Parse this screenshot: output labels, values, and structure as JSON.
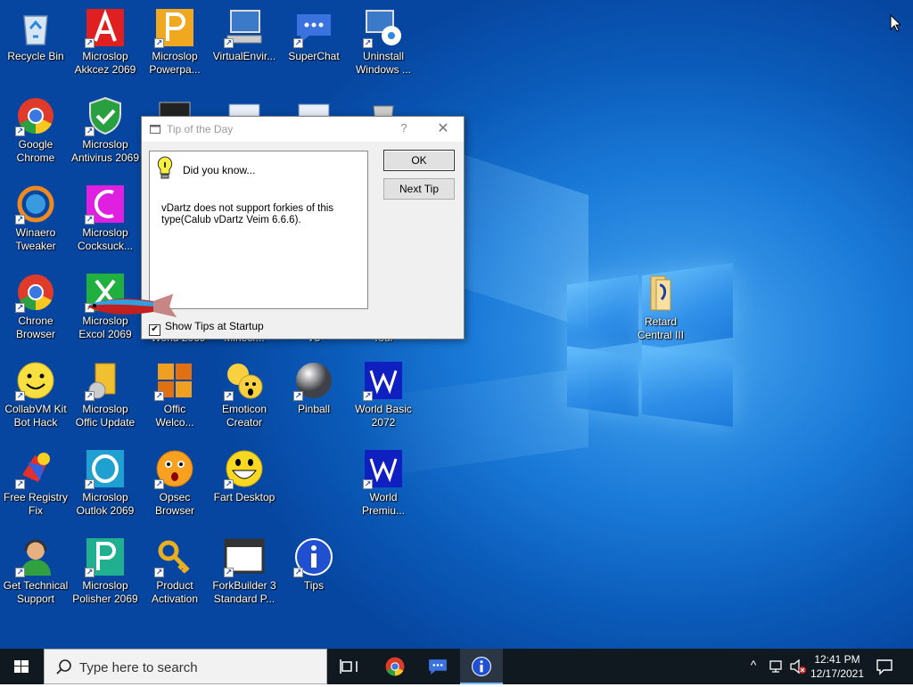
{
  "desktop": {
    "icons": [
      {
        "name": "Recycle Bin",
        "icon": "recycle-bin-icon",
        "shortcut": false
      },
      {
        "name": "Microslop\nAkkcez 2069",
        "icon": "access-icon",
        "shortcut": true
      },
      {
        "name": "Microslop\nPowerpa...",
        "icon": "powerpoint-icon",
        "shortcut": true
      },
      {
        "name": "VirtualEnvir...",
        "icon": "computer-icon",
        "shortcut": true
      },
      {
        "name": "SuperChat",
        "icon": "chat-icon",
        "shortcut": true
      },
      {
        "name": "Uninstall\nWindows ...",
        "icon": "uninstall-icon",
        "shortcut": true
      },
      {
        "name": "Google\nChrome",
        "icon": "chrome-icon",
        "shortcut": true
      },
      {
        "name": "Microslop\nAntivirus 2069",
        "icon": "antivirus-icon",
        "shortcut": true
      },
      {
        "name": "Winaero\nTweaker",
        "icon": "winaero-icon",
        "shortcut": true
      },
      {
        "name": "Microslop\nCocksuck...",
        "icon": "pink-app-icon",
        "shortcut": true
      },
      {
        "name": "Chrone\nBrowser",
        "icon": "chrome-icon",
        "shortcut": true
      },
      {
        "name": "Microslop\nExcol 2069",
        "icon": "excel-icon",
        "shortcut": true
      },
      {
        "name": "CollabVM Kit\nBot Hack",
        "icon": "smiley-icon",
        "shortcut": true
      },
      {
        "name": "Microslop\nOffic Update",
        "icon": "office-update-icon",
        "shortcut": true
      },
      {
        "name": "Offic\nWelco...",
        "icon": "office-icon",
        "shortcut": true
      },
      {
        "name": "Emoticon\nCreator",
        "icon": "emoticon-icon",
        "shortcut": true
      },
      {
        "name": "Pinball",
        "icon": "pinball-icon",
        "shortcut": true
      },
      {
        "name": "World Basic\n2072",
        "icon": "word-icon",
        "shortcut": true
      },
      {
        "name": "Free Registry\nFix",
        "icon": "registry-icon",
        "shortcut": true
      },
      {
        "name": "Microslop\nOutlok 2069",
        "icon": "outlook-icon",
        "shortcut": true
      },
      {
        "name": "Opsec\nBrowser",
        "icon": "opsec-icon",
        "shortcut": true
      },
      {
        "name": "Fart Desktop",
        "icon": "grin-icon",
        "shortcut": true
      },
      {
        "name": "World\nPremiu...",
        "icon": "word-icon",
        "shortcut": true
      },
      {
        "name": "Get Technical\nSupport",
        "icon": "support-icon",
        "shortcut": true
      },
      {
        "name": "Microslop\nPolisher 2069",
        "icon": "publisher-icon",
        "shortcut": true
      },
      {
        "name": "Product\nActivation",
        "icon": "key-icon",
        "shortcut": true
      },
      {
        "name": "ForkBuilder 3\nStandard P...",
        "icon": "window-icon",
        "shortcut": true
      },
      {
        "name": "Tips",
        "icon": "info-icon",
        "shortcut": true
      },
      {
        "name": "Retard\nCentral III",
        "icon": "folder-icon",
        "shortcut": false
      }
    ],
    "partial_labels": [
      "World 2069",
      "Minecr...",
      "V3",
      "Tour"
    ]
  },
  "dialog": {
    "title": "Tip of the Day",
    "help": "?",
    "close": "✕",
    "heading": "Did you know...",
    "tip": "vDartz does not support forkies of this type(Calub vDartz Veim 6.6.6).",
    "ok": "OK",
    "next": "Next Tip",
    "show_tips": "Show Tips at Startup",
    "show_tips_checked": true
  },
  "taskbar": {
    "search_placeholder": "Type here to search",
    "time": "12:41 PM",
    "date": "12/17/2021",
    "tray_chevron": "^"
  },
  "colors": {
    "taskbar": "#101820",
    "desktop_blue": "#0a5ab8",
    "dialog_bg": "#f0f0f0"
  }
}
